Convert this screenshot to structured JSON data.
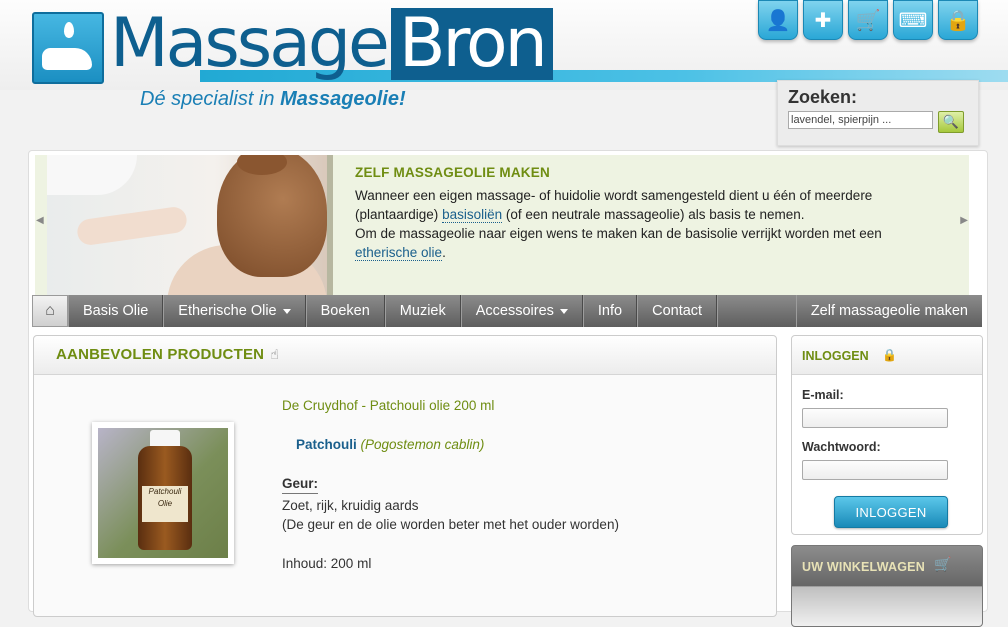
{
  "header": {
    "logo_left": "Massage",
    "logo_right": "Bron",
    "tagline_normal": "Dé specialist in ",
    "tagline_bold": "Massageolie!",
    "top_icons": [
      "user-icon",
      "add-document-icon",
      "cart-icon",
      "keyboard-icon",
      "lock-icon"
    ]
  },
  "search": {
    "title": "Zoeken:",
    "value": "lavendel, spierpijn ..."
  },
  "banner": {
    "title": "ZELF MASSAGEOLIE MAKEN",
    "p1_a": "Wanneer een eigen massage- of huidolie wordt samengesteld dient u één of meerdere (plantaardige) ",
    "p1_link": "basisoliën",
    "p1_b": " (of een neutrale massageolie) als basis te nemen.",
    "p2_a": "Om de massageolie naar eigen wens te maken kan de basisolie verrijkt worden met een ",
    "p2_link": "etherische olie",
    "p2_b": "."
  },
  "nav": {
    "items": [
      {
        "label": "Basis Olie"
      },
      {
        "label": "Etherische Olie"
      },
      {
        "label": "Boeken"
      },
      {
        "label": "Muziek"
      },
      {
        "label": "Accessoires"
      },
      {
        "label": "Info"
      },
      {
        "label": "Contact"
      }
    ],
    "right": "Zelf massageolie maken"
  },
  "products": {
    "title": "AANBEVOLEN PRODUCTEN",
    "item": {
      "name": "De Cruydhof - Patchouli olie 200 ml",
      "plant": "Patchouli",
      "latin": "(Pogostemon cablin)",
      "geur_title": "Geur:",
      "geur_line1": "Zoet, rijk, kruidig aards",
      "geur_line2": "(De geur en de olie worden beter met het ouder worden)",
      "inhoud": "Inhoud: 200 ml",
      "label_text": "Patchouli Olie"
    }
  },
  "login": {
    "title": "INLOGGEN",
    "email_label": "E-mail:",
    "password_label": "Wachtwoord:",
    "button": "INLOGGEN"
  },
  "cart": {
    "title": "UW WINKELWAGEN"
  },
  "colors": {
    "accent_green": "#6f8d12",
    "brand_blue": "#0e5f8f",
    "button_blue": "#1a8ab8"
  }
}
